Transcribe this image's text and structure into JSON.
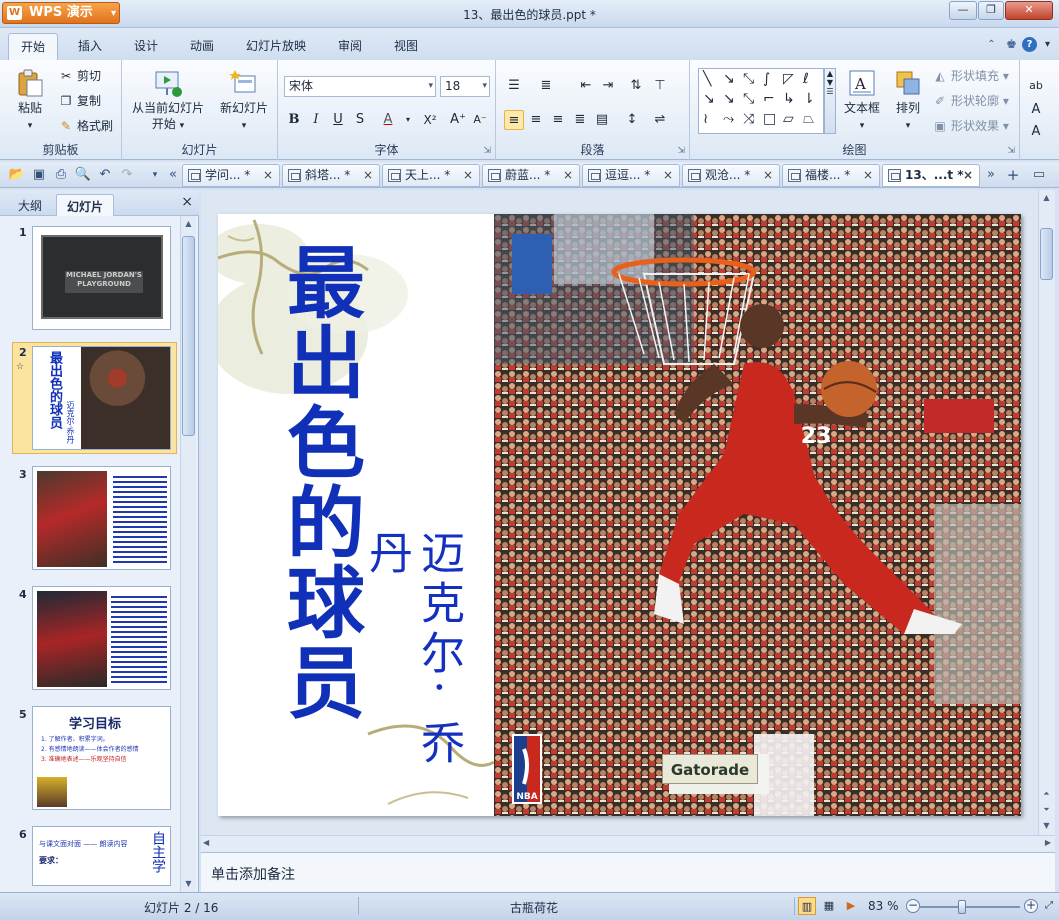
{
  "app": {
    "menu_button": "WPS 演示",
    "window_title": "13、最出色的球员.ppt *"
  },
  "ribbon_tabs": [
    "开始",
    "插入",
    "设计",
    "动画",
    "幻灯片放映",
    "审阅",
    "视图"
  ],
  "ribbon": {
    "clipboard": {
      "paste": "粘贴",
      "cut": "剪切",
      "copy": "复制",
      "format_painter": "格式刷",
      "group": "剪贴板"
    },
    "slides": {
      "from_current": "从当前幻灯片",
      "start": "开始",
      "new_slide": "新幻灯片",
      "group": "幻灯片"
    },
    "font": {
      "font_name": "宋体",
      "font_size": "18",
      "group": "字体"
    },
    "paragraph": {
      "group": "段落"
    },
    "drawing": {
      "text_box": "文本框",
      "arrange": "排列",
      "shape_fill": "形状填充",
      "shape_outline": "形状轮廓",
      "shape_effects": "形状效果",
      "group": "绘图"
    }
  },
  "file_tabs": [
    {
      "label": "学问...  *",
      "active": false
    },
    {
      "label": "斜塔...  *",
      "active": false
    },
    {
      "label": "天上...  *",
      "active": false
    },
    {
      "label": "蔚蓝...  *",
      "active": false
    },
    {
      "label": "逗逗...  *",
      "active": false
    },
    {
      "label": "观沧...  *",
      "active": false
    },
    {
      "label": "福楼...  *",
      "active": false
    },
    {
      "label": "13、...t *",
      "active": true
    }
  ],
  "left_pane": {
    "tab_outline": "大纲",
    "tab_slides": "幻灯片",
    "close": "×",
    "thumbnails": [
      {
        "num": "1",
        "caption": "MICHAEL JORDAN'S PLAYGROUND"
      },
      {
        "num": "2",
        "title": "最出色的球员",
        "subtitle": "迈克尔·乔丹",
        "marker": "☆"
      },
      {
        "num": "3"
      },
      {
        "num": "4"
      },
      {
        "num": "5",
        "heading": "学习目标",
        "lines": [
          "1. 了解作者、积累字词。",
          "2. 有感情地朗读——体会作者的感情",
          "3. 准确地表述——乐观坚持自信"
        ]
      },
      {
        "num": "6",
        "line1": "与课文面对面 —— 朗读内容",
        "line2": "要求：",
        "side": "自主学"
      }
    ]
  },
  "slide": {
    "title": "最出色的球员",
    "subtitle": "迈克尔· 乔丹",
    "jersey_number": "23",
    "banner": "Gatorade",
    "logo": "NBA"
  },
  "notes_placeholder": "单击添加备注",
  "status": {
    "slide_counter": "幻灯片 2 / 16",
    "theme": "古瓶荷花",
    "zoom": "83 %"
  },
  "colors": {
    "title_blue": "#1030b8",
    "accent_orange": "#e1731d",
    "ribbon_bg": "#dde8f5"
  }
}
